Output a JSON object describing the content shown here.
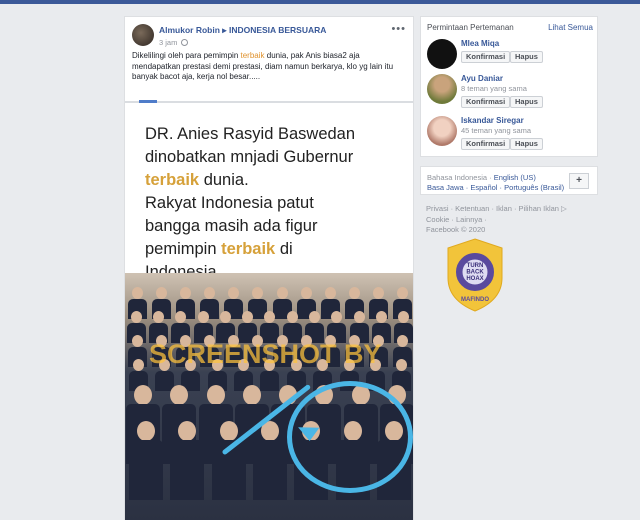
{
  "post": {
    "author": "Almukor Robin",
    "arrow": "▸",
    "group": "INDONESIA BERSUARA",
    "time": "3 jam",
    "more": "•••",
    "text_part1": "Dikelilingi oleh para pemimpin ",
    "text_highlight": "terbaik",
    "text_part2": " dunia, pak Anis biasa2 aja mendapatkan prestasi demi prestasi, diam namun berkarya, klo yg lain itu banyak bacot aja, kerja nol besar....."
  },
  "shared_image": {
    "line1": "DR. Anies Rasyid Baswedan",
    "line2": "dinobatkan mnjadi Gubernur",
    "line3_gold": "terbaik",
    "line3_rest": " dunia.",
    "line4": "Rakyat Indonesia patut",
    "line5": "bangga masih ada figur",
    "line6_a": "pemimpin ",
    "line6_gold": "terbaik",
    "line6_b": " di",
    "line7": "Indonesia.",
    "watermark": "SCREENSHOT BY"
  },
  "friend_requests": {
    "title": "Permintaan Pertemanan",
    "see_all": "Lihat Semua",
    "confirm_label": "Konfirmasi",
    "delete_label": "Hapus",
    "items": [
      {
        "name": "Mlea Miqa",
        "mutual": ""
      },
      {
        "name": "Ayu Daniar",
        "mutual": "8 teman yang sama"
      },
      {
        "name": "Iskandar Siregar",
        "mutual": "45 teman yang sama"
      }
    ]
  },
  "languages": {
    "current": "Bahasa Indonesia",
    "sep": " · ",
    "english": "English (US)",
    "jawa": "Basa Jawa",
    "espanol": "Español",
    "portugues": "Português (Brasil)",
    "plus": "+"
  },
  "footer": {
    "line1": "Privasi · Ketentuan · Iklan · Pilihan Iklan ▷",
    "line2": "Cookie · Lainnya ·",
    "line3": "Facebook © 2020"
  },
  "badge": {
    "center_line1": "TURN",
    "center_line2": "BACK",
    "center_line3": "HOAX",
    "bottom": "MAFINDO",
    "ring_text": "MASYARAKAT ANTI FITNAH INDONESIA"
  },
  "colors": {
    "facebook_blue": "#3b5998",
    "link_blue": "#385898",
    "highlight_orange": "#e0932f",
    "gold": "#d6a13a",
    "annotation_blue": "#4ab6e6",
    "badge_purple": "#5a4a9e",
    "badge_gold": "#f2c43a"
  }
}
